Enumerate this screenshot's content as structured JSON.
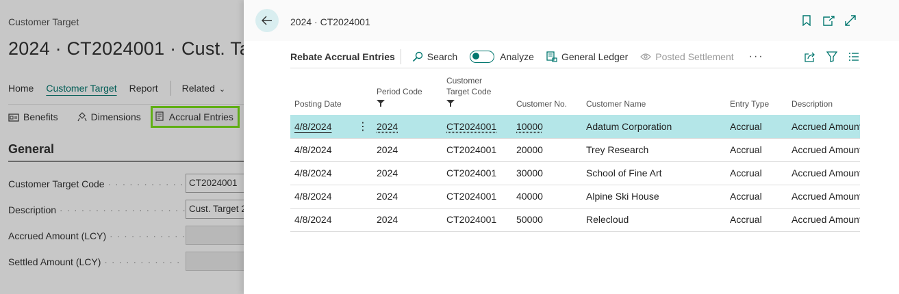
{
  "background_page": {
    "caption": "Customer Target",
    "title": "2024 · CT2024001 · Cust. Ta",
    "nav": {
      "home": "Home",
      "customer_target": "Customer Target",
      "report": "Report",
      "related": "Related"
    },
    "actions": {
      "benefits": "Benefits",
      "dimensions": "Dimensions",
      "accrual_entries": "Accrual Entries"
    },
    "section": "General",
    "fields": [
      {
        "label": "Customer Target Code",
        "value": "CT2024001"
      },
      {
        "label": "Description",
        "value": "Cust. Target 2"
      },
      {
        "label": "Accrued Amount (LCY)",
        "value": ""
      },
      {
        "label": "Settled Amount (LCY)",
        "value": ""
      }
    ],
    "highlight_color": "#7be11c"
  },
  "panel": {
    "title": "2024 · CT2024001",
    "toolbar": {
      "title": "Rebate Accrual Entries",
      "search": "Search",
      "analyze": "Analyze",
      "general_ledger": "General Ledger",
      "posted_settlement": "Posted Settlement",
      "more": "···"
    },
    "table": {
      "headers": {
        "posting_date": "Posting Date",
        "period_code": "Period Code",
        "customer_target_code_1": "Customer",
        "customer_target_code_2": "Target Code",
        "customer_no": "Customer No.",
        "customer_name": "Customer Name",
        "entry_type": "Entry Type",
        "description": "Description"
      },
      "rows": [
        {
          "posting_date": "4/8/2024",
          "period_code": "2024",
          "target_code": "CT2024001",
          "customer_no": "10000",
          "customer_name": "Adatum Corporation",
          "entry_type": "Accrual",
          "description": "Accrued Amount"
        },
        {
          "posting_date": "4/8/2024",
          "period_code": "2024",
          "target_code": "CT2024001",
          "customer_no": "20000",
          "customer_name": "Trey Research",
          "entry_type": "Accrual",
          "description": "Accrued Amount"
        },
        {
          "posting_date": "4/8/2024",
          "period_code": "2024",
          "target_code": "CT2024001",
          "customer_no": "30000",
          "customer_name": "School of Fine Art",
          "entry_type": "Accrual",
          "description": "Accrued Amount"
        },
        {
          "posting_date": "4/8/2024",
          "period_code": "2024",
          "target_code": "CT2024001",
          "customer_no": "40000",
          "customer_name": "Alpine Ski House",
          "entry_type": "Accrual",
          "description": "Accrued Amount"
        },
        {
          "posting_date": "4/8/2024",
          "period_code": "2024",
          "target_code": "CT2024001",
          "customer_no": "50000",
          "customer_name": "Relecloud",
          "entry_type": "Accrual",
          "description": "Accrued Amount"
        }
      ]
    },
    "accent_color": "#00766e",
    "selected_row_color": "#b4e6e8"
  }
}
